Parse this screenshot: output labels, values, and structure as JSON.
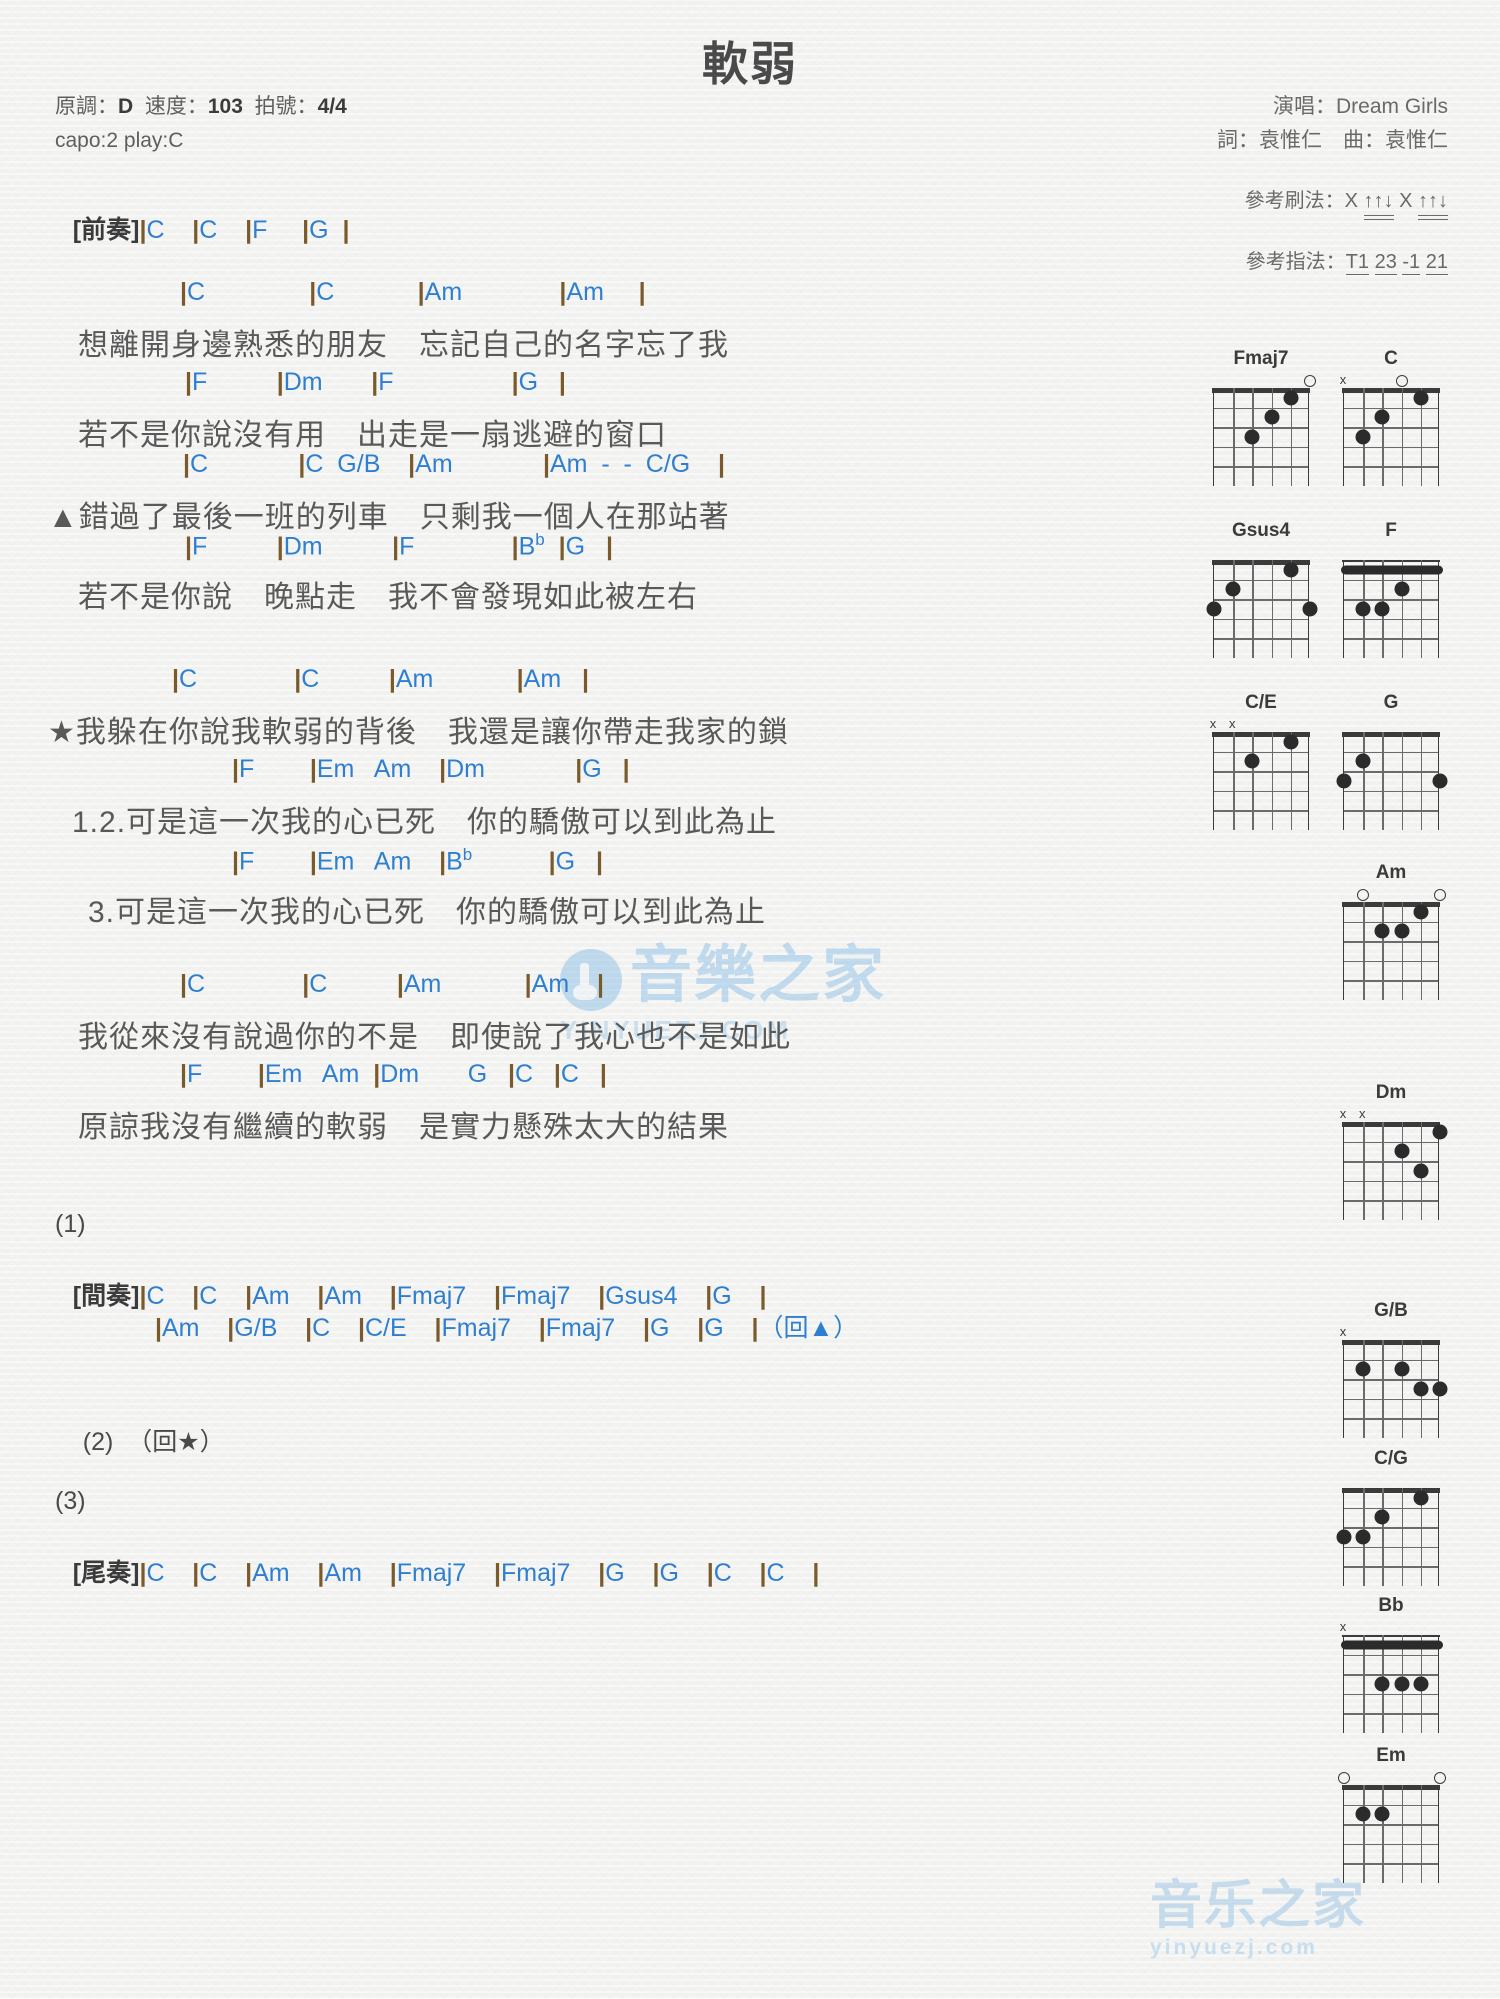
{
  "title": "軟弱",
  "meta_left": {
    "line1_key_label": "原調：",
    "line1_key_value": "D",
    "line1_tempo_label": "速度：",
    "line1_tempo_value": "103",
    "line1_time_label": "拍號：",
    "line1_time_value": "4/4",
    "line2": "capo:2 play:C"
  },
  "meta_right": {
    "singer": "演唱：Dream Girls",
    "credits": "詞：袁惟仁　曲：袁惟仁",
    "strum_label": "參考刷法：",
    "strum_pattern": "X ↑↑↓ X ↑↑↓",
    "finger_label": "參考指法：",
    "finger_pattern": "T1 23 -1 21"
  },
  "sections": {
    "intro_label": "[前奏]",
    "intro_chords": "|C    |C    |F     |G  |",
    "interlude_label": "[間奏]",
    "outro_label": "[尾奏]"
  },
  "blocks": [
    {
      "name": "verse1",
      "chords1": "|C               |C            |Am              |Am     |",
      "lyric1": "想離開身邊熟悉的朋友　忘記自己的名字忘了我",
      "chords2": "|F          |Dm       |F                 |G   |",
      "lyric2": "若不是你說沒有用　出走是一扇逃避的窗口"
    },
    {
      "name": "verse2",
      "chords1": "|C             |C  G/B    |Am             |Am  -  -  C/G    |",
      "lyric1": "▲錯過了最後一班的列車　只剩我一個人在那站著",
      "chords2": "|F          |Dm          |F              |B♭  |G   |",
      "lyric2": "若不是你說　晚點走　我不會發現如此被左右"
    },
    {
      "name": "chorus",
      "chords1": "|C              |C          |Am            |Am   |",
      "lyric1": "★我躲在你說我軟弱的背後　我還是讓你帶走我家的鎖",
      "chords2": "|F        |Em   Am    |Dm             |G   |",
      "lyric2": "1.2.可是這一次我的心已死　你的驕傲可以到此為止",
      "chords3": "|F        |Em   Am    |B♭           |G   |",
      "lyric3": "3.可是這一次我的心已死　你的驕傲可以到此為止"
    },
    {
      "name": "verse3",
      "chords1": "|C              |C          |Am            |Am    |",
      "lyric1": "我從來沒有說過你的不是　即使說了我心也不是如此",
      "chords2": "|F        |Em   Am  |Dm       G   |C   |C   |",
      "lyric2": "原諒我沒有繼續的軟弱　是實力懸殊太大的結果"
    }
  ],
  "endings": [
    {
      "num": "(1)",
      "note": ""
    },
    {
      "num": "(2)",
      "note": "（回★）"
    },
    {
      "num": "(3)",
      "note": ""
    }
  ],
  "interlude_lines": [
    "|C    |C    |Am    |Am    |Fmaj7    |Fmaj7    |Gsus4    |G    |",
    "|Am    |G/B    |C    |C/E    |Fmaj7    |Fmaj7    |G    |G    |（回▲）"
  ],
  "outro_line": "|C    |C    |Am    |Am    |Fmaj7    |Fmaj7    |G    |G    |C    |C    |",
  "colors": {
    "chord_blue": "#2f7fd0",
    "barline_brown": "#7a5a2a",
    "lyric_gray": "#595959",
    "heading_dark": "#3b3b3b",
    "watermark_blue": "#7ab6e6"
  },
  "watermarks": {
    "middle_text": "音樂之家",
    "middle_sub": "YINYUEZJ.COM",
    "bottom_text": "音乐之家",
    "bottom_sub": "yinyuezj.com"
  },
  "chord_diagrams": [
    {
      "name": "Fmaj7",
      "marks": [
        "",
        "",
        "",
        "",
        "",
        "o"
      ],
      "barre": null,
      "dots": [
        [
          4,
          3
        ],
        [
          3,
          2
        ],
        [
          2,
          1
        ]
      ]
    },
    {
      "name": "C",
      "marks": [
        "x",
        "",
        "",
        "o",
        "",
        ""
      ],
      "barre": null,
      "dots": [
        [
          5,
          3
        ],
        [
          4,
          2
        ],
        [
          2,
          1
        ]
      ]
    },
    {
      "name": "Gsus4",
      "marks": [
        "",
        "",
        "",
        "",
        "",
        ""
      ],
      "barre": null,
      "dots": [
        [
          6,
          3
        ],
        [
          5,
          2
        ],
        [
          2,
          1
        ],
        [
          1,
          3
        ]
      ]
    },
    {
      "name": "F",
      "marks": [
        "",
        "",
        "",
        "",
        "",
        ""
      ],
      "barre": 1,
      "dots": [
        [
          5,
          3
        ],
        [
          4,
          3
        ],
        [
          3,
          2
        ]
      ]
    },
    {
      "name": "C/E",
      "marks": [
        "x",
        "x",
        "",
        "",
        "",
        ""
      ],
      "barre": null,
      "dots": [
        [
          4,
          2
        ],
        [
          2,
          1
        ]
      ]
    },
    {
      "name": "G",
      "marks": [
        "",
        "",
        "",
        "",
        "",
        ""
      ],
      "barre": null,
      "dots": [
        [
          6,
          3
        ],
        [
          5,
          2
        ],
        [
          1,
          3
        ]
      ]
    },
    {
      "name": "Am",
      "marks": [
        "",
        "o",
        "",
        "",
        "",
        "o"
      ],
      "barre": null,
      "dots": [
        [
          4,
          2
        ],
        [
          3,
          2
        ],
        [
          2,
          1
        ]
      ]
    },
    {
      "name": "Dm",
      "marks": [
        "x",
        "x",
        "",
        "",
        "",
        ""
      ],
      "barre": null,
      "dots": [
        [
          3,
          2
        ],
        [
          2,
          3
        ],
        [
          1,
          1
        ]
      ]
    },
    {
      "name": "G/B",
      "marks": [
        "x",
        "",
        "",
        "",
        "",
        ""
      ],
      "barre": null,
      "dots": [
        [
          5,
          2
        ],
        [
          3,
          2
        ],
        [
          2,
          3
        ],
        [
          1,
          3
        ]
      ]
    },
    {
      "name": "C/G",
      "marks": [
        "",
        "",
        "",
        "",
        "",
        ""
      ],
      "barre": null,
      "dots": [
        [
          6,
          3
        ],
        [
          5,
          3
        ],
        [
          4,
          2
        ],
        [
          2,
          1
        ]
      ]
    },
    {
      "name": "Bb",
      "marks": [
        "x",
        "",
        "",
        "",
        "",
        ""
      ],
      "barre": 1,
      "dots": [
        [
          4,
          3
        ],
        [
          3,
          3
        ],
        [
          2,
          3
        ]
      ]
    },
    {
      "name": "Em",
      "marks": [
        "o",
        "",
        "",
        "",
        "",
        "o"
      ],
      "barre": null,
      "dots": [
        [
          5,
          2
        ],
        [
          4,
          2
        ]
      ]
    }
  ]
}
